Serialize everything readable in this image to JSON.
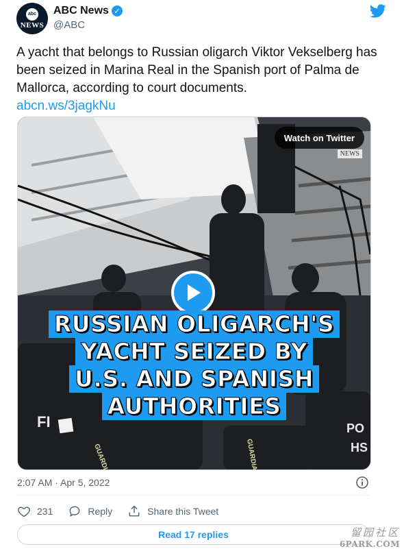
{
  "account": {
    "display_name": "ABC News",
    "handle": "@ABC",
    "avatar_top_text": "abc",
    "avatar_bottom_text": "NEWS",
    "verified": true
  },
  "tweet": {
    "text": "A yacht that belongs to Russian oligarch Viktor Vekselberg has been seized in Marina Real in the Spanish port of Palma de Mallorca, according to court documents.",
    "link": "abcn.ws/3jagkNu",
    "timestamp": "2:07 AM · Apr 5, 2022"
  },
  "media": {
    "watch_button": "Watch on Twitter",
    "news_bug": "NEWS",
    "headline_lines": [
      "RUSSIAN OLIGARCH'S",
      "YACHT SEIZED BY",
      "U.S. AND SPANISH",
      "AUTHORITIES"
    ],
    "vest_labels": [
      "FI",
      "GUARDIA CIVIL",
      "GUARDIA CIVIL",
      "PO",
      "HS"
    ]
  },
  "actions": {
    "like_count": "231",
    "reply_label": "Reply",
    "share_label": "Share this Tweet"
  },
  "read_replies": "Read 17 replies",
  "watermark": {
    "cn": "留园社区",
    "en": "6PARK.COM"
  },
  "colors": {
    "accent": "#1d9bf0",
    "text": "#0f1419",
    "secondary": "#536471"
  },
  "icons": [
    "verified-badge-icon",
    "twitter-bird-icon",
    "play-icon",
    "info-icon",
    "heart-icon",
    "reply-bubble-icon",
    "share-icon"
  ]
}
